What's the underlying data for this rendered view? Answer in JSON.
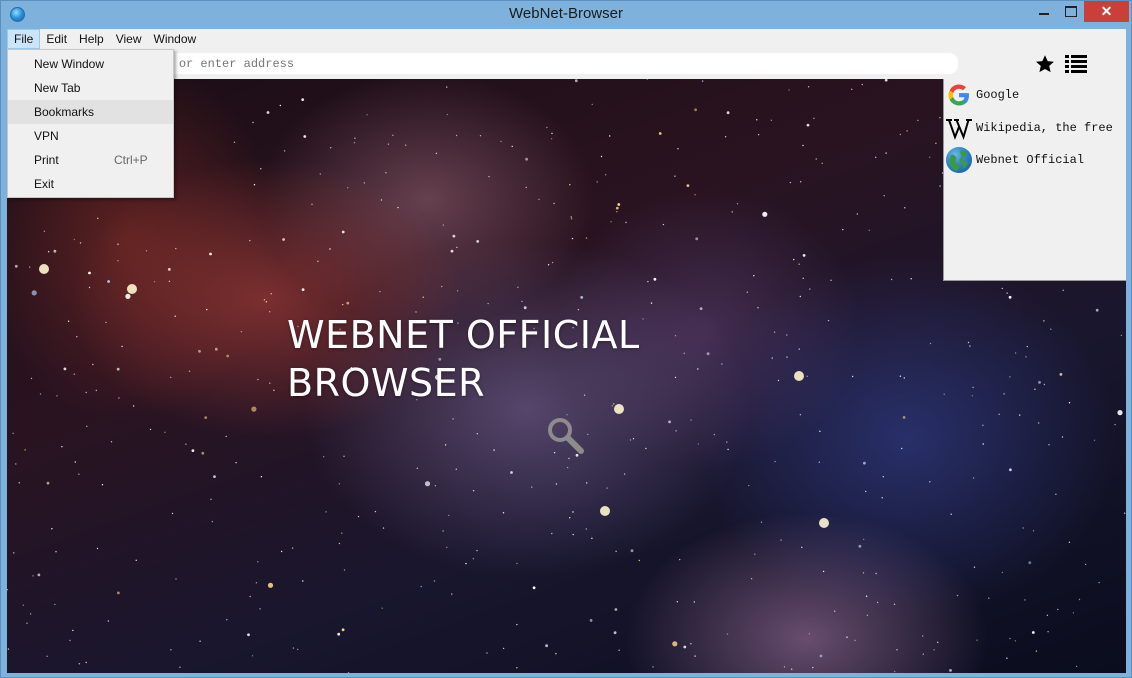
{
  "window": {
    "title": "WebNet-Browser",
    "close_label": "✕"
  },
  "menubar": {
    "items": [
      "File",
      "Edit",
      "Help",
      "View",
      "Window"
    ]
  },
  "file_menu": {
    "items": [
      {
        "label": "New Window",
        "shortcut": ""
      },
      {
        "label": "New Tab",
        "shortcut": ""
      },
      {
        "label": "Bookmarks",
        "shortcut": ""
      },
      {
        "label": "VPN",
        "shortcut": ""
      },
      {
        "label": "Print",
        "shortcut": "Ctrl+P"
      },
      {
        "label": "Exit",
        "shortcut": ""
      }
    ],
    "highlighted": "Bookmarks"
  },
  "toolbar": {
    "address_placeholder": "Search with Google or enter address",
    "icons": [
      "star-icon",
      "list-icon"
    ]
  },
  "page": {
    "hero_line1": "WEBNET OFFICIAL",
    "hero_line2": "BROWSER",
    "icon": "search-icon"
  },
  "bookmarks": {
    "items": [
      {
        "label": "Google",
        "icon": "google-icon"
      },
      {
        "label": "Wikipedia, the free",
        "icon": "wikipedia-icon"
      },
      {
        "label": "Webnet Official",
        "icon": "globe-icon"
      }
    ]
  },
  "colors": {
    "frame": "#7eb2dd",
    "close_button": "#c9403a",
    "menu_bg": "#f0f0f0"
  }
}
